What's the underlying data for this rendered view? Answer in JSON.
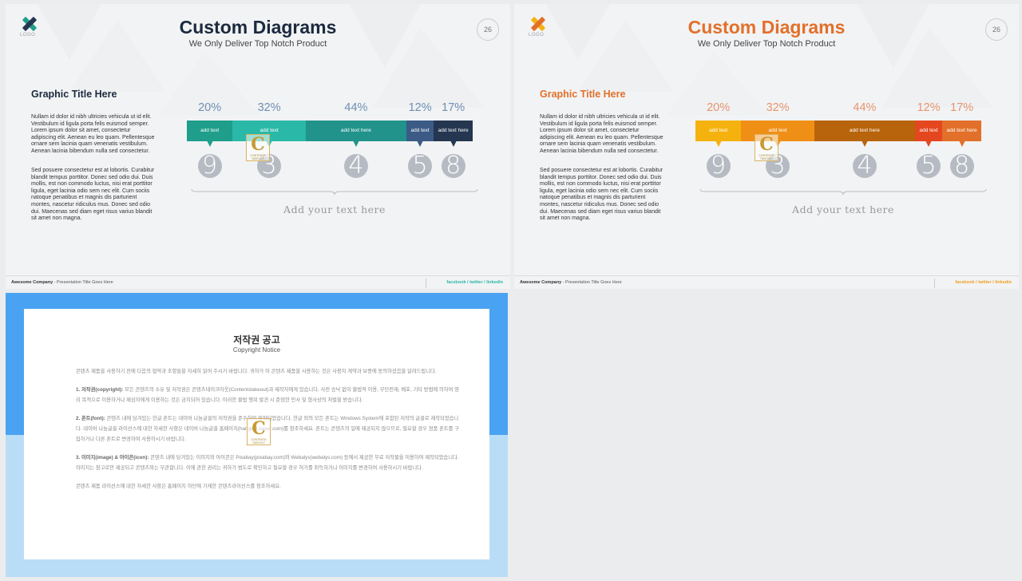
{
  "slides": [
    {
      "theme": "dark",
      "accent": "#1b2a3f",
      "logo_label": "LOGO",
      "title": "Custom Diagrams",
      "subtitle": "We Only Deliver Top Notch Product",
      "page_number": "26",
      "graphic_title": "Graphic Title Here",
      "body_p1": "Nullam id dolor id nibh ultricies vehicula ut id elit. Vestibulum id ligula porta felis euismod semper. Lorem ipsum dolor sit amet, consectetur adipiscing elit. Aenean eu leo quam. Pellentesque ornare sem lacinia quam venenatis vestibulum. Aenean lacinia bibendum nulla sed consectetur.",
      "body_p2": "Sed posuere consectetur est at lobortis. Curabitur blandit tempus porttitor. Donec sed odio dui. Duis mollis, est non commodo luctus, nisi erat porttitor ligula, eget lacinia odio sem nec elit. Cum sociis natoque penatibus et magnis dis parturient montes, nascetur ridiculus mus. Donec sed odio dui. Maecenas sed diam eget risus varius blandit sit amet non magna.",
      "segments": [
        {
          "percent": "20%",
          "value": 20,
          "label": "add text",
          "color": "#1e9e8b",
          "number": "9"
        },
        {
          "percent": "32%",
          "value": 32,
          "label": "add text",
          "color": "#2ab8a8",
          "number": "3"
        },
        {
          "percent": "44%",
          "value": 44,
          "label": "add text here",
          "color": "#21938b",
          "number": "4"
        },
        {
          "percent": "12%",
          "value": 12,
          "label": "add text",
          "color": "#3b5a86",
          "number": "5"
        },
        {
          "percent": "17%",
          "value": 17,
          "label": "add text here",
          "color": "#243650",
          "number": "8"
        }
      ],
      "percent_color": "#6f8fb3",
      "add_text": "Add your text here",
      "footer_company": "Awesome Company",
      "footer_title": " - Presentation Title Goes Here",
      "social": [
        "facebook",
        "twitter",
        "linkedin"
      ],
      "social_color": "#2ab8a8",
      "logo_colors": [
        "#1e9e8b",
        "#243650"
      ]
    },
    {
      "theme": "orange",
      "accent": "#e2702a",
      "logo_label": "LOGO",
      "title": "Custom Diagrams",
      "subtitle": "We Only Deliver Top Notch Product",
      "page_number": "26",
      "graphic_title": "Graphic Title Here",
      "body_p1": "Nullam id dolor id nibh ultricies vehicula ut id elit. Vestibulum id ligula porta felis euismod semper. Lorem ipsum dolor sit amet, consectetur adipiscing elit. Aenean eu leo quam. Pellentesque ornare sem lacinia quam venenatis vestibulum. Aenean lacinia bibendum nulla sed consectetur.",
      "body_p2": "Sed posuere consectetur est at lobortis. Curabitur blandit tempus porttitor. Donec sed odio dui. Duis mollis, est non commodo luctus, nisi erat porttitor ligula, eget lacinia odio sem nec elit. Cum sociis natoque penatibus et magnis dis parturient montes, nascetur ridiculus mus. Donec sed odio dui. Maecenas sed diam eget risus varius blandit sit amet non magna.",
      "segments": [
        {
          "percent": "20%",
          "value": 20,
          "label": "add text",
          "color": "#f5b20f",
          "number": "9"
        },
        {
          "percent": "32%",
          "value": 32,
          "label": "add text",
          "color": "#ef8f16",
          "number": "3"
        },
        {
          "percent": "44%",
          "value": 44,
          "label": "add text here",
          "color": "#b8640c",
          "number": "4"
        },
        {
          "percent": "12%",
          "value": 12,
          "label": "add text",
          "color": "#e4471f",
          "number": "5"
        },
        {
          "percent": "17%",
          "value": 17,
          "label": "add text here",
          "color": "#e2702a",
          "number": "8"
        }
      ],
      "percent_color": "#e79470",
      "add_text": "Add your text here",
      "footer_company": "Awesome Company",
      "footer_title": " - Presentation Title Goes Here",
      "social": [
        "facebook",
        "twitter",
        "linkedin"
      ],
      "social_color": "#f0a025",
      "logo_colors": [
        "#f5b20f",
        "#e2702a"
      ]
    }
  ],
  "watermark": {
    "letter": "C",
    "text": "CONTENTS TAKEOUT"
  },
  "copyright": {
    "title": "저작권 공고",
    "subtitle": "Copyright Notice",
    "intro": "콘텐츠 제품을 사용하기 전에 다음의 협약과 조항들을 자세히 읽어 주시기 바랍니다. 귀하가 이 콘텐츠 제품을 사용하는 것은 사용자 계약과 보증에 동의하셨음을 알려드립니다.",
    "p1_head": "1. 저작권(copyright):",
    "p1": " 모든 콘텐츠의 소유 및 저작권은 콘텐츠테이크아웃(Contentstakeout)과 제작자에게 있습니다. 사전 승낙 없이 불법적 이용, 무단전재, 배포, 기타 방법에 의하여 영리 목적으로 이용하거나 제삼자에게 이용하는 것은 금지되어 있습니다. 이러한 불법 행위 발견 시 준엄한 민사 및 형사상의 처벌을 받습니다.",
    "p2_head": "2. 폰트(font):",
    "p2": " 콘텐츠 내에 담겨있는 한글 폰트는 네이버 나눔글꼴의 저작권을 준수하여 제작되었습니다. 한글 외의 모든 폰트는 Windows System에 포함된 저작의 글꼴로 제작되었습니다. 네이버 나눔글꼴 라이선스에 대한 자세한 사항은 네이버 나눔글꼴 홈페이지(hangeul.naver.com)를 참조하세요. 폰트는 콘텐츠의 일에 제공되지 않으므로, 필요할 경우 정품 폰트를 구입하거나 다른 폰트로 변경하여 사용하시기 바랍니다.",
    "p3_head": "3. 이미지(image) & 아이콘(icon):",
    "p3": " 콘텐츠 내에 담겨있는 이미지와 아이콘은 Pixabay(pixabay.com)와 Webalys(webalys.com) 등에서 제공한 무료 저작물을 이용하여 제작되었습니다. 이미지는 참고로만 제공되고 콘텐츠와는 무관합니다. 이에 관한 권리는 귀하가 범도로 확인하고 필요할 경우 허가를 취득하거나 이미지를 변경하여 사용하시기 바랍니다.",
    "outro": "콘텐츠 제품 라이선스에 대한 자세한 사항은 홈페이지 하단에 기재한 콘텐츠라이선스를 참조하세요."
  }
}
